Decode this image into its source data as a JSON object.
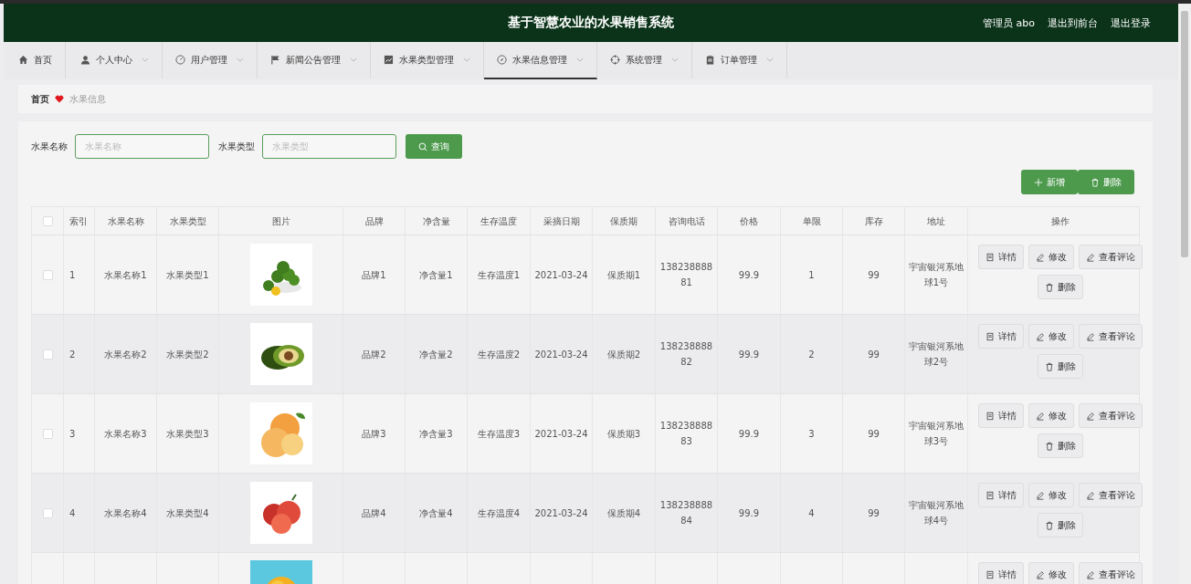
{
  "header": {
    "title": "基于智慧农业的水果销售系统",
    "links": [
      "管理员 abo",
      "退出到前台",
      "退出登录"
    ]
  },
  "nav": [
    {
      "label": "首页",
      "dropdown": false,
      "selected": false
    },
    {
      "label": "个人中心",
      "dropdown": true,
      "selected": false
    },
    {
      "label": "用户管理",
      "dropdown": true,
      "selected": false
    },
    {
      "label": "新闻公告管理",
      "dropdown": true,
      "selected": false
    },
    {
      "label": "水果类型管理",
      "dropdown": true,
      "selected": false
    },
    {
      "label": "水果信息管理",
      "dropdown": true,
      "selected": true
    },
    {
      "label": "系统管理",
      "dropdown": true,
      "selected": false
    },
    {
      "label": "订单管理",
      "dropdown": true,
      "selected": false
    }
  ],
  "breadcrumb": [
    "首页",
    "水果信息"
  ],
  "search": {
    "fields": [
      {
        "label": "水果名称",
        "placeholder": "水果名称"
      },
      {
        "label": "水果类型",
        "placeholder": "水果类型"
      }
    ],
    "button": "查询"
  },
  "toolbar": [
    "新增",
    "删除"
  ],
  "table": {
    "all_checked": false,
    "columns": [
      "索引",
      "水果名称",
      "水果类型",
      "图片",
      "品牌",
      "净含量",
      "生存温度",
      "采摘日期",
      "保质期",
      "咨询电话",
      "价格",
      "单限",
      "库存",
      "地址",
      "操作"
    ],
    "rows": [
      {
        "checked": false,
        "cells": [
          "1",
          "水果名称1",
          "水果类型1",
          null,
          "品牌1",
          "净含量1",
          "生存温度1",
          "2021-03-24",
          "保质期1",
          "13823888881",
          "99.9",
          "1",
          "99",
          "宇宙银河系地球1号"
        ],
        "actions": [
          "详情",
          "修改",
          "查看评论",
          "删除"
        ]
      },
      {
        "checked": false,
        "cells": [
          "2",
          "水果名称2",
          "水果类型2",
          null,
          "品牌2",
          "净含量2",
          "生存温度2",
          "2021-03-24",
          "保质期2",
          "13823888882",
          "99.9",
          "2",
          "99",
          "宇宙银河系地球2号"
        ],
        "actions": [
          "详情",
          "修改",
          "查看评论",
          "删除"
        ]
      },
      {
        "checked": false,
        "cells": [
          "3",
          "水果名称3",
          "水果类型3",
          null,
          "品牌3",
          "净含量3",
          "生存温度3",
          "2021-03-24",
          "保质期3",
          "13823888883",
          "99.9",
          "3",
          "99",
          "宇宙银河系地球3号"
        ],
        "actions": [
          "详情",
          "修改",
          "查看评论",
          "删除"
        ]
      },
      {
        "checked": false,
        "cells": [
          "4",
          "水果名称4",
          "水果类型4",
          null,
          "品牌4",
          "净含量4",
          "生存温度4",
          "2021-03-24",
          "保质期4",
          "13823888884",
          "99.9",
          "4",
          "99",
          "宇宙银河系地球4号"
        ],
        "actions": [
          "详情",
          "修改",
          "查看评论",
          "删除"
        ]
      },
      {
        "cells": [
          null,
          null,
          null,
          null,
          null,
          null,
          null,
          null,
          null,
          null,
          null,
          null,
          null,
          null
        ],
        "actions": [
          "详情",
          "修改",
          "查看评论"
        ]
      }
    ]
  }
}
